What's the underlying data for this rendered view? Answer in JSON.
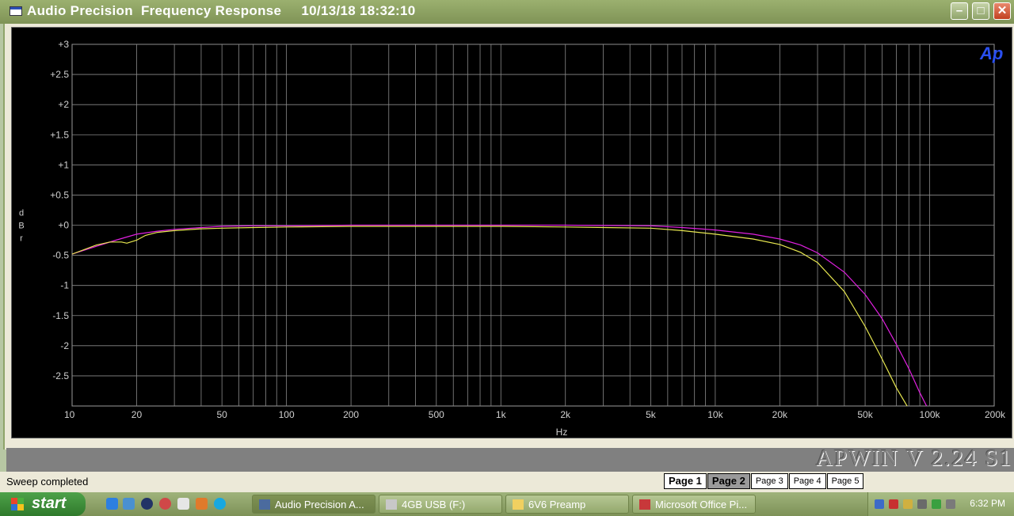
{
  "window": {
    "title": "Audio Precision  Frequency Response     10/13/18 18:32:10",
    "minimize_icon": "minimize-icon",
    "maximize_icon": "maximize-icon",
    "close_icon": "close-icon"
  },
  "chart_data": {
    "type": "line",
    "xscale": "log",
    "xlim": [
      10,
      200000
    ],
    "ylim": [
      -3,
      3
    ],
    "xlabel": "Hz",
    "ylabel": "dBr",
    "yticks": [
      3,
      2.5,
      2,
      1.5,
      1,
      0.5,
      0,
      -0.5,
      -1,
      -1.5,
      -2,
      -2.5
    ],
    "ytick_labels": [
      "+3",
      "+2.5",
      "+2",
      "+1.5",
      "+1",
      "+0.5",
      "+0",
      "-0.5",
      "-1",
      "-1.5",
      "-2",
      "-2.5"
    ],
    "xticks": [
      10,
      20,
      50,
      100,
      200,
      500,
      1000,
      2000,
      5000,
      10000,
      20000,
      50000,
      100000,
      200000
    ],
    "xtick_labels": [
      "10",
      "20",
      "50",
      "100",
      "200",
      "500",
      "1k",
      "2k",
      "5k",
      "10k",
      "20k",
      "50k",
      "100k",
      "200k"
    ],
    "grid": true,
    "logo": "Ap",
    "series": [
      {
        "color": "#e020e0",
        "x": [
          10,
          13,
          16,
          20,
          25,
          30,
          40,
          50,
          70,
          100,
          200,
          500,
          1000,
          2000,
          5000,
          7000,
          10000,
          15000,
          20000,
          25000,
          30000,
          40000,
          50000,
          60000,
          70000,
          80000,
          90000,
          100000
        ],
        "y": [
          -0.48,
          -0.35,
          -0.25,
          -0.15,
          -0.1,
          -0.07,
          -0.04,
          -0.02,
          -0.01,
          -0.01,
          0,
          0,
          0,
          0,
          -0.01,
          -0.04,
          -0.08,
          -0.15,
          -0.23,
          -0.33,
          -0.46,
          -0.78,
          -1.15,
          -1.55,
          -1.98,
          -2.38,
          -2.78,
          -3.1
        ]
      },
      {
        "color": "#e8e850",
        "x": [
          10,
          13,
          15,
          17,
          18,
          20,
          22,
          25,
          30,
          40,
          50,
          70,
          100,
          200,
          500,
          1000,
          2000,
          5000,
          7000,
          10000,
          15000,
          20000,
          25000,
          30000,
          40000,
          50000,
          60000,
          70000,
          80000,
          85000
        ],
        "y": [
          -0.48,
          -0.33,
          -0.28,
          -0.28,
          -0.3,
          -0.25,
          -0.17,
          -0.12,
          -0.09,
          -0.06,
          -0.05,
          -0.04,
          -0.03,
          -0.02,
          -0.02,
          -0.02,
          -0.03,
          -0.05,
          -0.09,
          -0.15,
          -0.23,
          -0.32,
          -0.45,
          -0.62,
          -1.1,
          -1.68,
          -2.22,
          -2.7,
          -3.05,
          -3.2
        ]
      }
    ]
  },
  "version_banner": "APWIN V 2.24  S1",
  "status": "Sweep completed",
  "pages": [
    "Page 1",
    "Page 2",
    "Page 3",
    "Page 4",
    "Page 5"
  ],
  "selected_page": "Page 2",
  "taskbar": {
    "start": "start",
    "tasks": [
      {
        "label": "Audio Precision A...",
        "icon": "ap-icon",
        "active": true
      },
      {
        "label": "4GB USB (F:)",
        "icon": "drive-icon",
        "active": false
      },
      {
        "label": "6V6 Preamp",
        "icon": "folder-icon",
        "active": false
      },
      {
        "label": "Microsoft Office Pi...",
        "icon": "office-picture-icon",
        "active": false
      }
    ],
    "clock": "6:32 PM"
  }
}
